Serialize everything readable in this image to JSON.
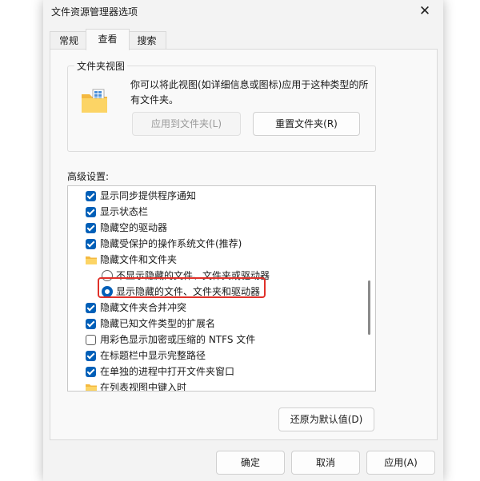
{
  "window": {
    "title": "文件资源管理器选项",
    "close_glyph": "✕"
  },
  "tabs": [
    {
      "label": "常规",
      "active": false
    },
    {
      "label": "查看",
      "active": true
    },
    {
      "label": "搜索",
      "active": false
    }
  ],
  "folder_views": {
    "legend": "文件夹视图",
    "description": "你可以将此视图(如详细信息或图标)应用于这种类型的所有文件夹。",
    "apply_button": "应用到文件夹(L)",
    "reset_button": "重置文件夹(R)"
  },
  "advanced": {
    "label": "高级设置:",
    "items": [
      {
        "type": "checkbox",
        "checked": true,
        "label": "显示同步提供程序通知"
      },
      {
        "type": "checkbox",
        "checked": true,
        "label": "显示状态栏"
      },
      {
        "type": "checkbox",
        "checked": true,
        "label": "隐藏空的驱动器"
      },
      {
        "type": "checkbox",
        "checked": true,
        "label": "隐藏受保护的操作系统文件(推荐)"
      },
      {
        "type": "folder",
        "label": "隐藏文件和文件夹"
      },
      {
        "type": "radio",
        "selected": false,
        "label": "不显示隐藏的文件、文件夹或驱动器"
      },
      {
        "type": "radio",
        "selected": true,
        "label": "显示隐藏的文件、文件夹和驱动器"
      },
      {
        "type": "checkbox",
        "checked": true,
        "label": "隐藏文件夹合并冲突"
      },
      {
        "type": "checkbox",
        "checked": true,
        "label": "隐藏已知文件类型的扩展名"
      },
      {
        "type": "checkbox",
        "checked": false,
        "label": "用彩色显示加密或压缩的 NTFS 文件"
      },
      {
        "type": "checkbox",
        "checked": true,
        "label": "在标题栏中显示完整路径"
      },
      {
        "type": "checkbox",
        "checked": true,
        "label": "在单独的进程中打开文件夹窗口"
      },
      {
        "type": "folder",
        "label": "在列表视图中键入时"
      }
    ],
    "restore_button": "还原为默认值(D)"
  },
  "footer": {
    "ok": "确定",
    "cancel": "取消",
    "apply": "应用(A)"
  },
  "colors": {
    "accent": "#005fb8",
    "highlight": "#e0312a"
  }
}
